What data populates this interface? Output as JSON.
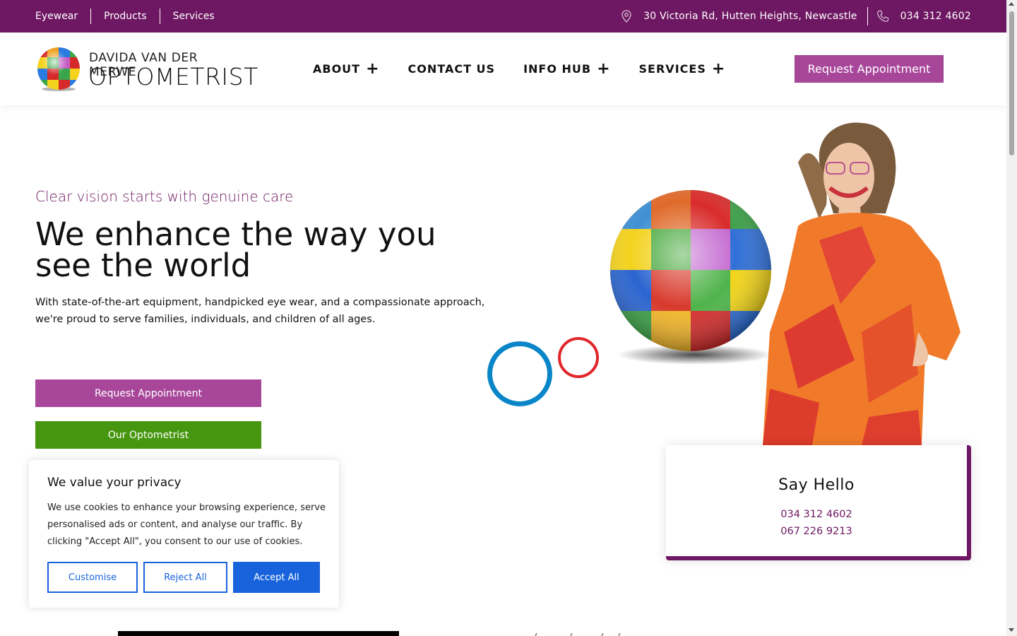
{
  "topbar": {
    "links": [
      "Eyewear",
      "Products",
      "Services"
    ],
    "address": "30 Victoria Rd, Hutten Heights, Newcastle",
    "phone": "034 312 4602",
    "address_icon": "location-pin-icon",
    "phone_icon": "phone-icon"
  },
  "header": {
    "logo_line1": "DAVIDA VAN DER MERWE",
    "logo_line2": "OPTOMETRIST",
    "nav": [
      {
        "label": "ABOUT",
        "has_submenu": true
      },
      {
        "label": "CONTACT US",
        "has_submenu": false
      },
      {
        "label": "INFO HUB",
        "has_submenu": true
      },
      {
        "label": "SERVICES",
        "has_submenu": true
      }
    ],
    "submenu_symbol": "+",
    "cta": "Request Appointment"
  },
  "hero": {
    "tagline": "Clear vision starts with genuine care",
    "headline": "We enhance the way you see the world",
    "intro": "With state-of-the-art equipment, handpicked eye wear, and a compassionate approach, we're proud to serve families, individuals, and children of all ages.",
    "btn_request": "Request Appointment",
    "btn_optometrist": "Our Optometrist"
  },
  "say_hello": {
    "title": "Say Hello",
    "phone1": "034 312 4602",
    "phone2": "067 226 9213"
  },
  "cookie": {
    "title": "We value your privacy",
    "body": "We use cookies to enhance your browsing experience, serve personalised ads or content, and analyse our traffic.  By clicking \"Accept All\", you consent to our use of cookies.",
    "customise": "Customise",
    "reject": "Reject All",
    "accept": "Accept All"
  },
  "colors": {
    "brand_purple": "#6e1762",
    "button_purple": "#a8479a",
    "button_green": "#46960f",
    "cookie_blue": "#1863dc",
    "deco_blue": "#0a86c8",
    "deco_red": "#e0262b"
  }
}
